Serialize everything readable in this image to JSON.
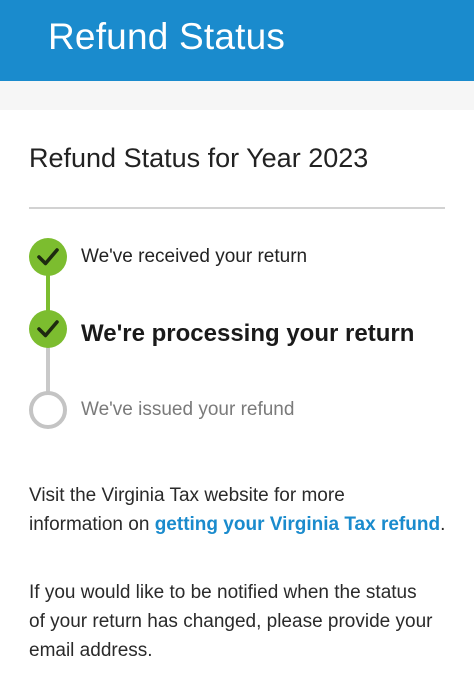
{
  "header": {
    "title": "Refund Status"
  },
  "card": {
    "title": "Refund Status for Year 2023"
  },
  "steps": [
    {
      "label": "We've received your return",
      "state": "done"
    },
    {
      "label": "We're processing your return",
      "state": "current"
    },
    {
      "label": "We've issued your refund",
      "state": "pending"
    }
  ],
  "info": {
    "line1": "Visit the Virginia Tax website for more",
    "line2_prefix": "information on ",
    "link_text": "getting your Virginia Tax refund",
    "line2_suffix": "."
  },
  "notify": {
    "line1": "If you would like to be notified when the status",
    "line2": "of your return has changed, please provide your",
    "line3": "email address."
  },
  "colors": {
    "header_bg": "#1a8bcd",
    "link": "#1a8bcd",
    "step_complete": "#7cbd2f",
    "step_pending": "#c4c4c4"
  }
}
